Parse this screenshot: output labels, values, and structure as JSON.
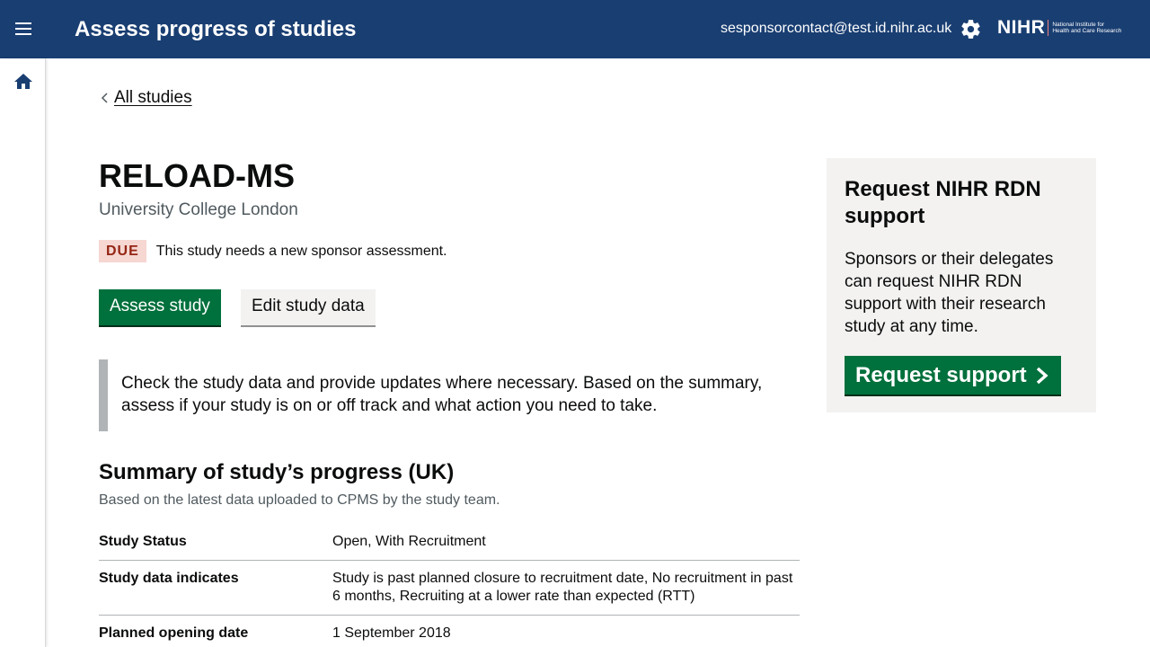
{
  "header": {
    "title": "Assess progress of studies",
    "user_email": "sesponsorcontact@test.id.nihr.ac.uk",
    "logo_word": "NIHR",
    "logo_sub_1": "National Institute for",
    "logo_sub_2": "Health and Care Research",
    "background_color": "#193e72"
  },
  "breadcrumb": {
    "back_label": "All studies"
  },
  "study": {
    "title": "RELOAD-MS",
    "organisation": "University College London",
    "status_tag": "DUE",
    "status_text": "This study needs a new sponsor assessment."
  },
  "actions": {
    "assess_label": "Assess study",
    "edit_label": "Edit study data"
  },
  "inset_text": "Check the study data and provide updates where necessary. Based on the summary, assess if your study is on or off track and what action you need to take.",
  "summary": {
    "title": "Summary of study’s progress (UK)",
    "subtitle": "Based on the latest data uploaded to CPMS by the study team.",
    "rows": [
      {
        "key": "Study Status",
        "value": "Open, With Recruitment"
      },
      {
        "key": "Study data indicates",
        "value": "Study is past planned closure to recruitment date, No recruitment in past 6 months, Recruiting at a lower rate than expected (RTT)"
      },
      {
        "key": "Planned opening date",
        "value": "1 September 2018"
      }
    ]
  },
  "support_panel": {
    "title": "Request NIHR RDN support",
    "body": "Sponsors or their delegates can request NIHR RDN support with their research study at any time.",
    "button_label": "Request support"
  },
  "icons": {
    "menu": "menu-icon",
    "settings": "gear-icon",
    "home": "home-icon",
    "back": "chevron-left-icon",
    "request": "chevron-right-icon"
  },
  "colors": {
    "primary_green": "#00703c",
    "due_bg": "#f6d7d2",
    "due_text": "#942514",
    "panel_bg": "#f3f2f1"
  }
}
